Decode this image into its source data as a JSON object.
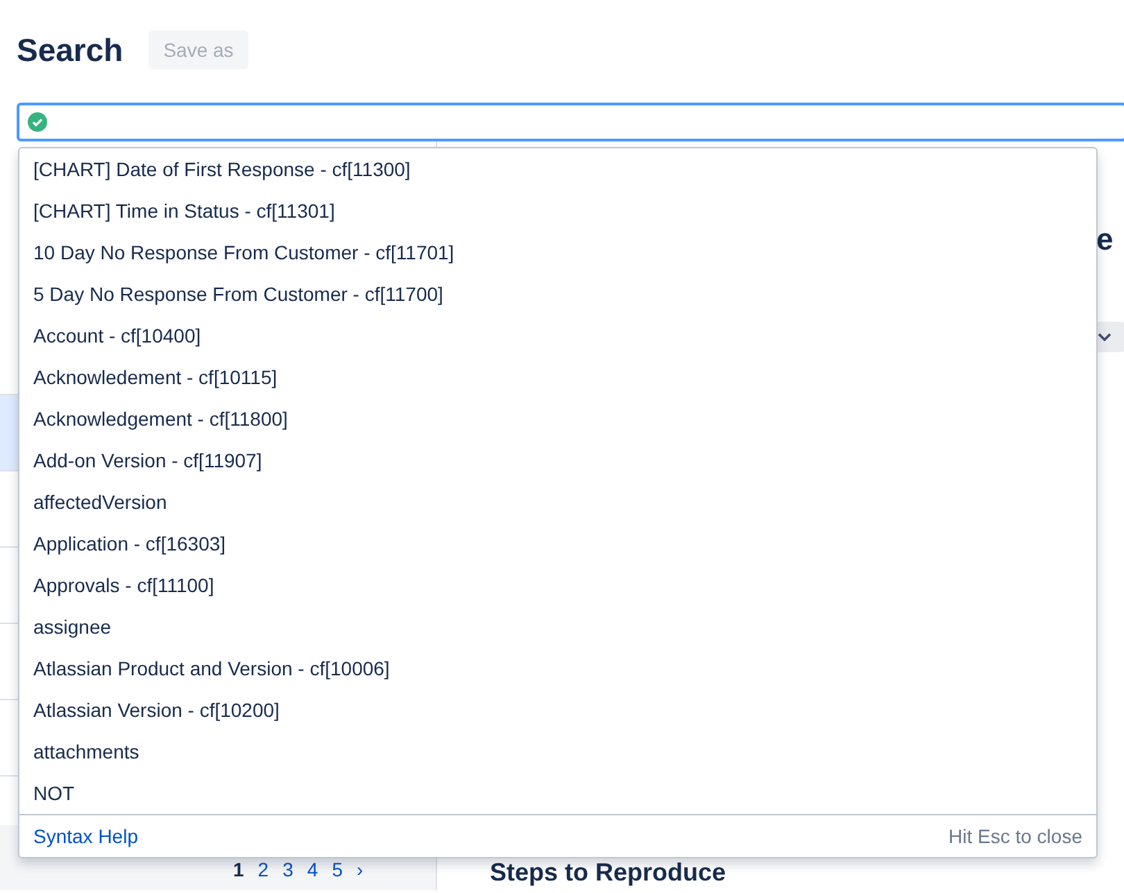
{
  "header": {
    "title": "Search",
    "save_button": {
      "label": "Save as",
      "disabled": true
    }
  },
  "query": {
    "valid": true
  },
  "suggestions": [
    {
      "label": "[CHART] Date of First Response - cf[11300]"
    },
    {
      "label": "[CHART] Time in Status - cf[11301]"
    },
    {
      "label": "10 Day No Response From Customer - cf[11701]"
    },
    {
      "label": "5 Day No Response From Customer - cf[11700]"
    },
    {
      "label": "Account - cf[10400]"
    },
    {
      "label": "Acknowledement - cf[10115]"
    },
    {
      "label": "Acknowledgement - cf[11800]"
    },
    {
      "label": "Add-on Version - cf[11907]"
    },
    {
      "label": "affectedVersion"
    },
    {
      "label": "Application - cf[16303]"
    },
    {
      "label": "Approvals - cf[11100]"
    },
    {
      "label": "assignee"
    },
    {
      "label": "Atlassian Product and Version - cf[10006]"
    },
    {
      "label": "Atlassian Version - cf[10200]"
    },
    {
      "label": "attachments"
    },
    {
      "label": "NOT"
    }
  ],
  "suggestion_footer": {
    "help_link": "Syntax Help",
    "hint": "Hit Esc to close"
  },
  "issue_list": {
    "rows": [
      {
        "selected": false
      },
      {
        "selected": true
      },
      {
        "selected": false
      },
      {
        "selected": false
      },
      {
        "selected": false
      },
      {
        "selected": false
      }
    ]
  },
  "pagination": {
    "pages": [
      {
        "label": "1",
        "selected": true
      },
      {
        "label": "2",
        "selected": false
      },
      {
        "label": "3",
        "selected": false
      },
      {
        "label": "4",
        "selected": false
      },
      {
        "label": "5",
        "selected": false
      }
    ],
    "next": "›"
  },
  "detail": {
    "heading_fragment": "e",
    "section_heading": "Steps to Reproduce"
  }
}
